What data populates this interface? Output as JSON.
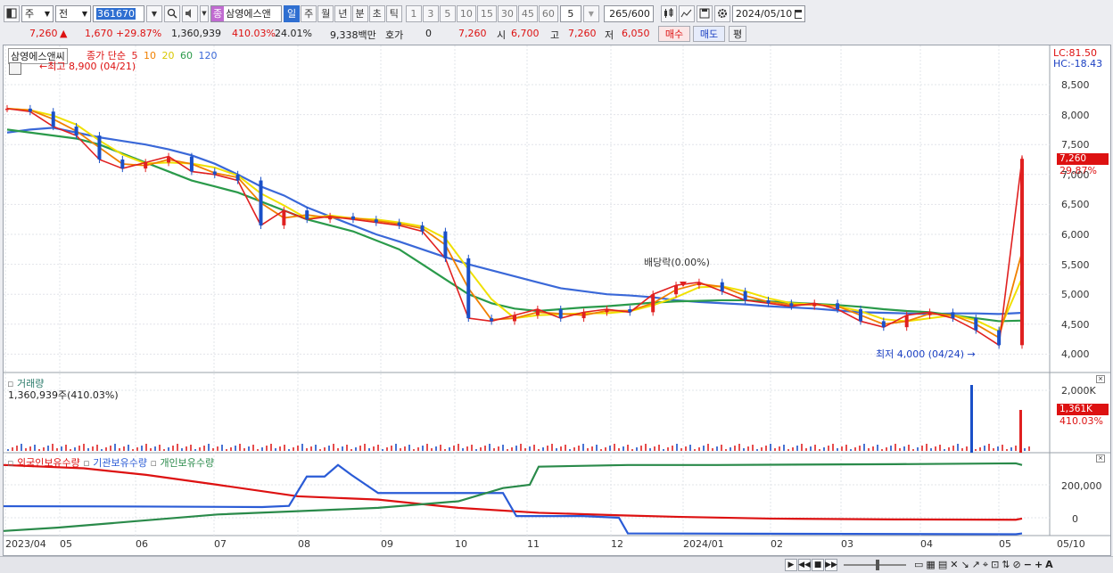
{
  "toolbar": {
    "market_label": "주",
    "type_label": "전",
    "code": "361670",
    "name": "삼영에스앤",
    "name_tag": "종",
    "periods": [
      "일",
      "주",
      "월",
      "년",
      "분",
      "초",
      "틱"
    ],
    "active_period": "일",
    "intervals": [
      "1",
      "3",
      "5",
      "10",
      "15",
      "30",
      "45",
      "60"
    ],
    "interval_value": "5",
    "count": "265",
    "count_total": "/600",
    "date": "2024/05/10"
  },
  "quote": {
    "price": "7,260",
    "change": "1,670",
    "change_pct": "+29.87%",
    "volume": "1,360,939",
    "volume_ratio": "410.03%",
    "turnover_rate": "24.01%",
    "amount": "9,338백만",
    "hoga_label": "호가",
    "hoga_value": "0",
    "hoga_price": "7,260",
    "open_label": "시",
    "open": "6,700",
    "high_label": "고",
    "high": "7,260",
    "low_label": "저",
    "low": "6,050",
    "buy_label": "매수",
    "sell_label": "매도",
    "eval_label": "평"
  },
  "price_panel": {
    "stock_name": "삼영에스앤씨",
    "legend_title": "종가 단순",
    "ma_labels": [
      "5",
      "10",
      "20",
      "60",
      "120"
    ],
    "ma_colors": [
      "#e02020",
      "#f08000",
      "#f0e000",
      "#2a9a4a",
      "#3a68d8"
    ],
    "high_note": "최고 8,900 (04/21)",
    "low_note": "최저 4,000 (04/24)",
    "dividend_note": "배당락(0.00%)",
    "lc_label": "LC:81.50",
    "hc_label": "HC:-18.43",
    "price_tag": "7,260",
    "pct_tag": "29.87%",
    "y_ticks": [
      "8,500",
      "8,000",
      "7,500",
      "7,000",
      "6,500",
      "6,000",
      "5,500",
      "5,000",
      "4,500",
      "4,000"
    ]
  },
  "volume_panel": {
    "title": "거래량",
    "value": "1,360,939주(410.03%)",
    "y_ticks": [
      "2,000K",
      "1,000K"
    ],
    "tag": "1,361K",
    "tag_pct": "410.03%"
  },
  "holdings_panel": {
    "legend": [
      "외국인보유수량",
      "기관보유수량",
      "개인보유수량"
    ],
    "colors": [
      "#d11",
      "#2a5bd6",
      "#2a8a4a"
    ],
    "y_ticks": [
      "200,000",
      "0"
    ]
  },
  "x_ticks": [
    "2023/04",
    "05",
    "06",
    "07",
    "08",
    "09",
    "10",
    "11",
    "12",
    "2024/01",
    "02",
    "03",
    "04",
    "05",
    "05/10"
  ],
  "chart_data": {
    "type": "line",
    "title": "삼영에스앤씨 일봉",
    "y_range": [
      3800,
      8900
    ],
    "x_months": [
      "2023/04",
      "05",
      "06",
      "07",
      "08",
      "09",
      "10",
      "11",
      "12",
      "2024/01",
      "02",
      "03",
      "04",
      "05"
    ],
    "series": [
      {
        "name": "close",
        "values": [
          8100,
          8050,
          7800,
          7650,
          7250,
          7100,
          7200,
          7300,
          7050,
          7000,
          6900,
          6150,
          6400,
          6250,
          6300,
          6250,
          6200,
          6150,
          6050,
          5600,
          4600,
          4550,
          4650,
          4750,
          4600,
          4700,
          4750,
          4700,
          5000,
          5150,
          5200,
          5050,
          4900,
          4850,
          4800,
          4850,
          4750,
          4550,
          4450,
          4650,
          4700,
          4600,
          4400,
          4150,
          7260
        ]
      },
      {
        "name": "ma120",
        "values": [
          7700,
          7750,
          7780,
          7700,
          7620,
          7560,
          7500,
          7420,
          7320,
          7180,
          7000,
          6800,
          6650,
          6450,
          6300,
          6150,
          6000,
          5880,
          5750,
          5620,
          5500,
          5400,
          5300,
          5200,
          5100,
          5050,
          5000,
          4980,
          4950,
          4900,
          4870,
          4850,
          4830,
          4800,
          4780,
          4760,
          4730,
          4700,
          4690,
          4680,
          4670,
          4680,
          4680,
          4670,
          4690
        ]
      },
      {
        "name": "ma60",
        "values": [
          7750,
          7700,
          7650,
          7600,
          7500,
          7350,
          7200,
          7050,
          6900,
          6800,
          6700,
          6550,
          6400,
          6250,
          6150,
          6050,
          5900,
          5750,
          5500,
          5250,
          5000,
          4850,
          4760,
          4720,
          4750,
          4780,
          4800,
          4830,
          4860,
          4880,
          4890,
          4900,
          4900,
          4880,
          4860,
          4840,
          4820,
          4790,
          4750,
          4720,
          4700,
          4650,
          4600,
          4550,
          4560
        ]
      }
    ],
    "volume_spikes": [
      {
        "date": "04/24",
        "value": 2250000
      },
      {
        "date": "05/10",
        "value": 1360939
      }
    ],
    "holdings": {
      "foreign_range": [
        320000,
        -10000
      ],
      "institution_peak": 330000,
      "individual_end": 320000
    }
  }
}
